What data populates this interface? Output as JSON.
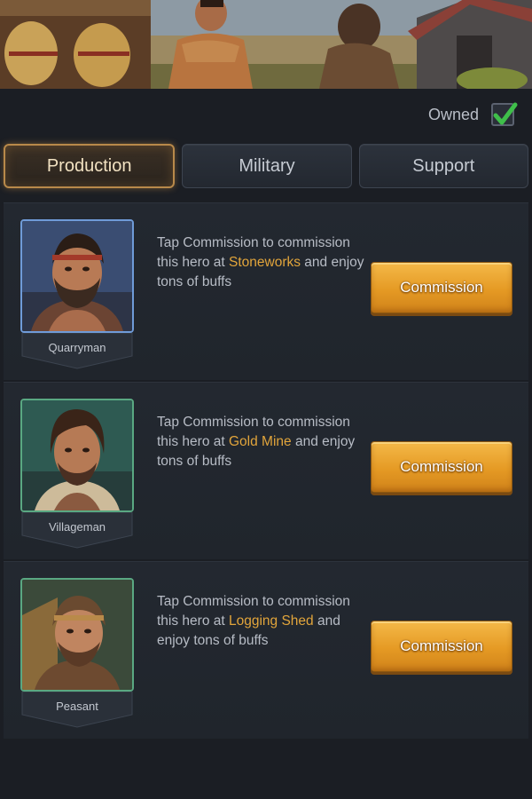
{
  "filter": {
    "owned_label": "Owned",
    "owned_checked": true
  },
  "tabs": [
    {
      "label": "Production",
      "active": true
    },
    {
      "label": "Military",
      "active": false
    },
    {
      "label": "Support",
      "active": false
    }
  ],
  "heroes": [
    {
      "name": "Quarryman",
      "desc_prefix": "Tap Commission to commission this hero at ",
      "building": "Stoneworks",
      "desc_suffix": " and enjoy tons of buffs",
      "button": "Commission",
      "frame_color": "#6f9bd8"
    },
    {
      "name": "Villageman",
      "desc_prefix": "Tap Commission to commission this hero at ",
      "building": "Gold Mine",
      "desc_suffix": " and enjoy tons of buffs",
      "button": "Commission",
      "frame_color": "#5aa882"
    },
    {
      "name": "Peasant",
      "desc_prefix": "Tap Commission to commission this hero at ",
      "building": "Logging Shed",
      "desc_suffix": " and enjoy tons of buffs",
      "button": "Commission",
      "frame_color": "#5aa882"
    }
  ],
  "colors": {
    "highlight": "#e2a53b",
    "button": "#e59a24",
    "tab_active_border": "#b8894a"
  }
}
